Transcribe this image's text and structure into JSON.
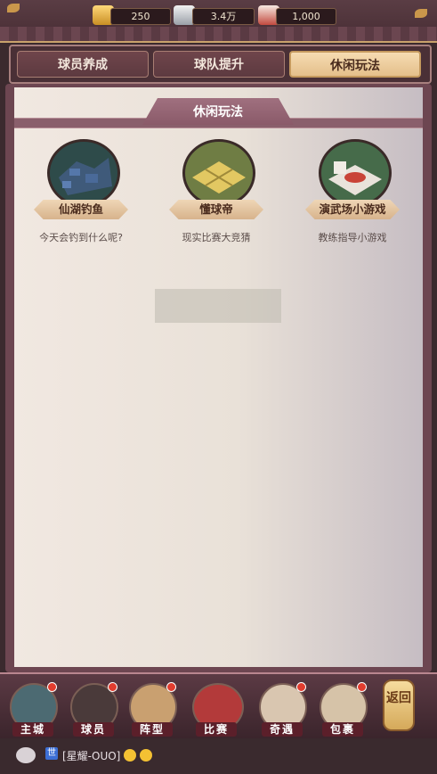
{
  "resources": [
    {
      "name": "gold",
      "value": "250"
    },
    {
      "name": "silver",
      "value": "3.4万"
    },
    {
      "name": "gift",
      "value": "1,000"
    }
  ],
  "tabs": [
    {
      "label": "球员养成",
      "active": false
    },
    {
      "label": "球队提升",
      "active": false
    },
    {
      "label": "休闲玩法",
      "active": true
    }
  ],
  "section_title": "休闲玩法",
  "games": [
    {
      "name": "仙湖钓鱼",
      "desc": "今天会钓到什么呢?"
    },
    {
      "name": "懂球帝",
      "desc": "现实比赛大竞猜"
    },
    {
      "name": "演武场小游戏",
      "desc": "教练指导小游戏"
    }
  ],
  "coming_soon": "",
  "nav": [
    {
      "label": "主城"
    },
    {
      "label": "球员"
    },
    {
      "label": "阵型"
    },
    {
      "label": "比赛"
    },
    {
      "label": "奇遇"
    },
    {
      "label": "包裹"
    }
  ],
  "back_label": "返回",
  "chat": {
    "channel": "世",
    "text": "[星耀-OUO]"
  },
  "colors": {
    "accent": "#e4bf8b",
    "panel": "#6d4651"
  }
}
